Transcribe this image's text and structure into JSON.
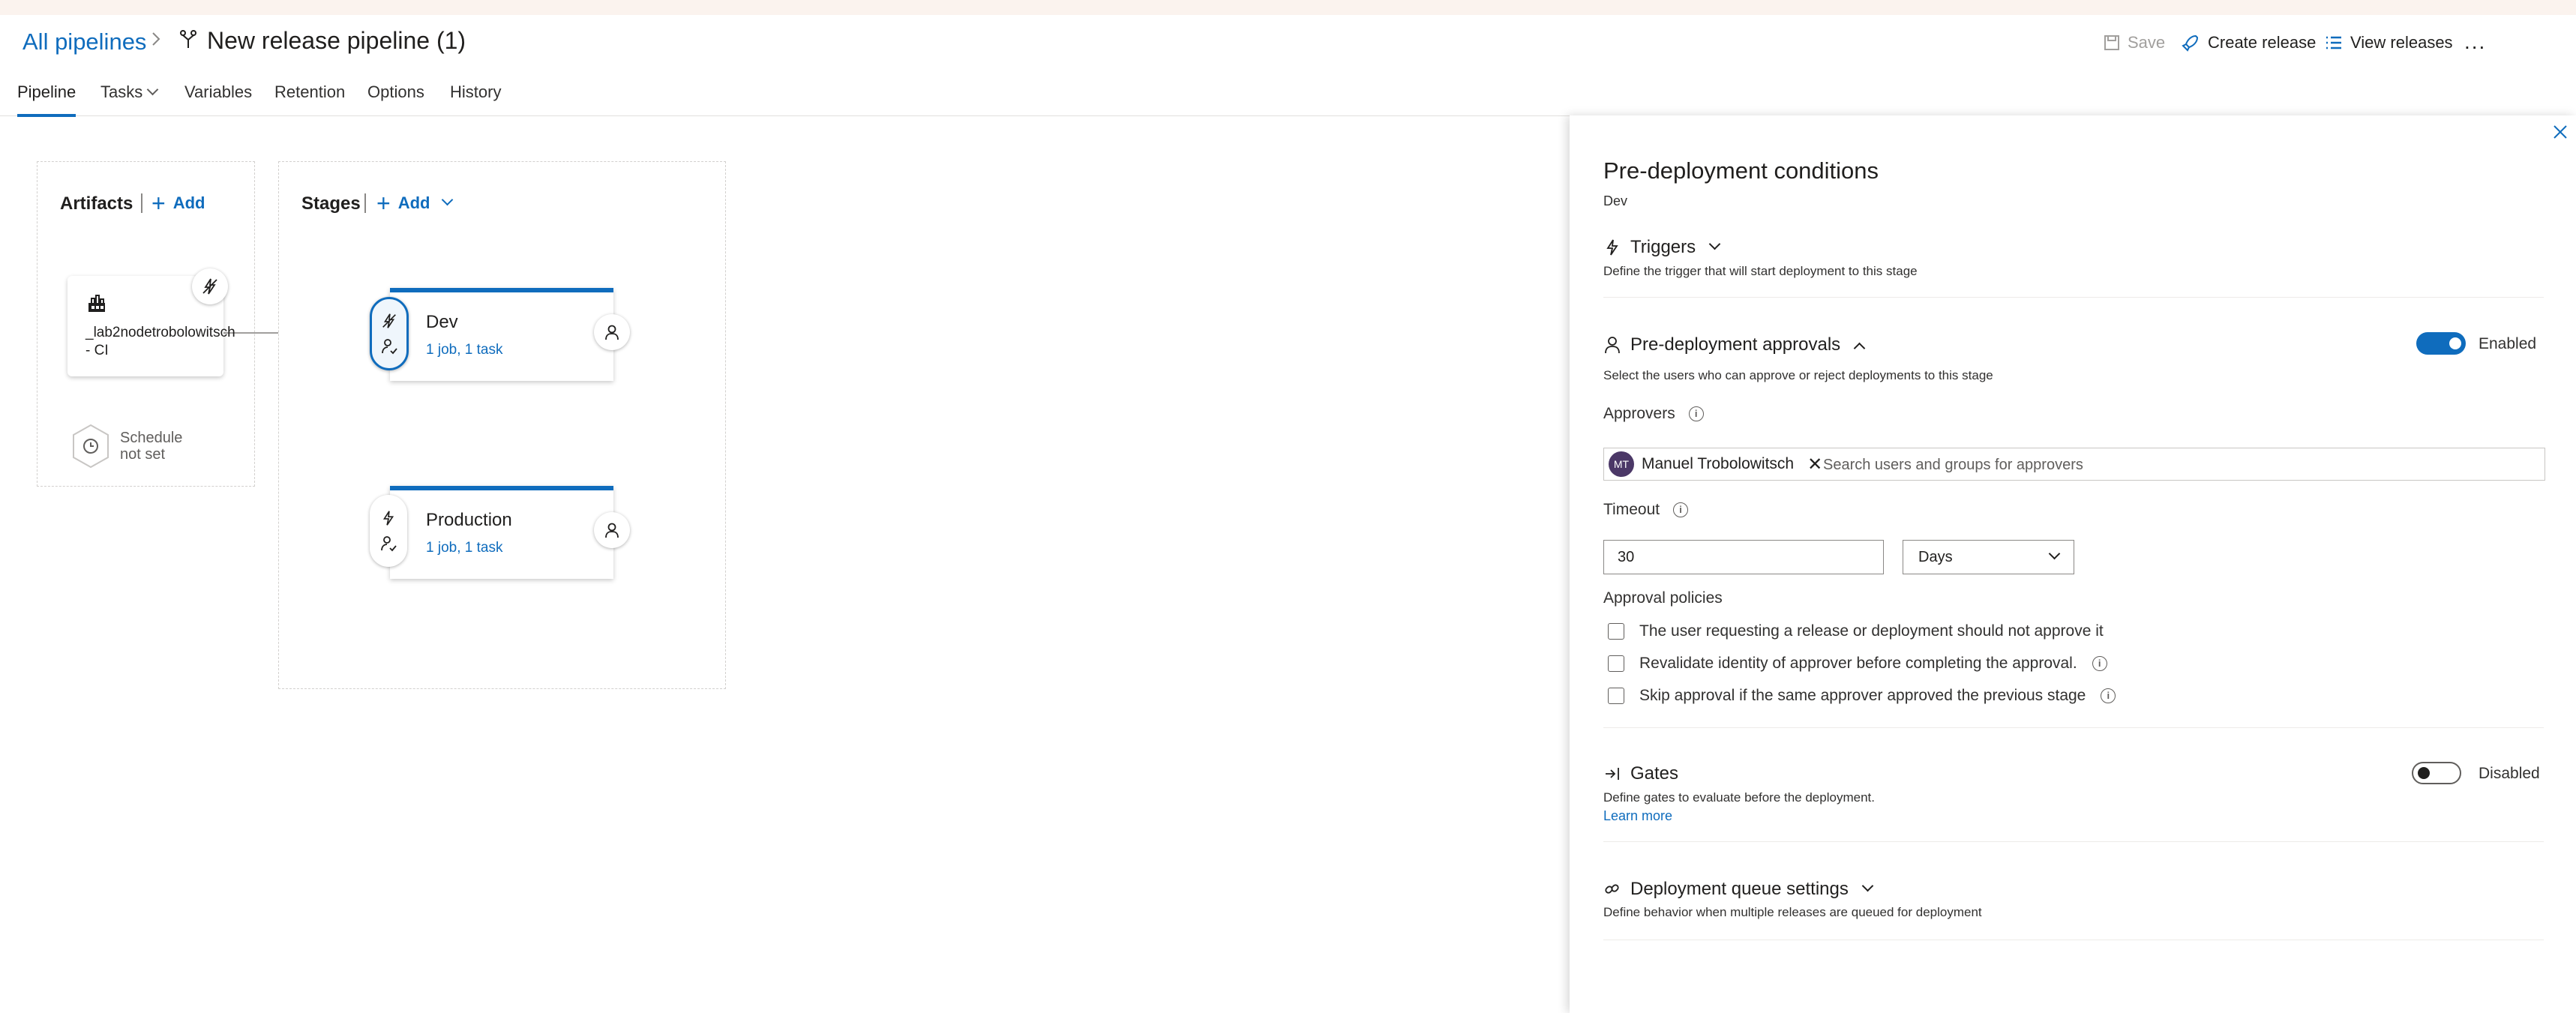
{
  "header": {
    "breadcrumb_root": "All pipelines",
    "pipeline_title": "New release pipeline (1)",
    "save_label": "Save",
    "create_release_label": "Create release",
    "view_releases_label": "View releases",
    "more_label": "..."
  },
  "tabs": [
    {
      "label": "Pipeline",
      "active": true
    },
    {
      "label": "Tasks"
    },
    {
      "label": "Variables"
    },
    {
      "label": "Retention"
    },
    {
      "label": "Options"
    },
    {
      "label": "History"
    }
  ],
  "artifacts": {
    "title": "Artifacts",
    "add_label": "Add",
    "items": [
      {
        "name": "_lab2nodetrobolowitsch - CI"
      }
    ],
    "schedule_line1": "Schedule",
    "schedule_line2": "not set"
  },
  "stages": {
    "title": "Stages",
    "add_label": "Add",
    "items": [
      {
        "name": "Dev",
        "summary": "1 job, 1 task",
        "selected": true
      },
      {
        "name": "Production",
        "summary": "1 job, 1 task",
        "selected": false
      }
    ]
  },
  "panel": {
    "title": "Pre-deployment conditions",
    "subtitle": "Dev",
    "triggers": {
      "label": "Triggers",
      "description": "Define the trigger that will start deployment to this stage"
    },
    "approvals": {
      "label": "Pre-deployment approvals",
      "toggle_label": "Enabled",
      "enabled": true,
      "description": "Select the users who can approve or reject deployments to this stage",
      "approvers_label": "Approvers",
      "approver": {
        "initials": "MT",
        "name": "Manuel Trobolowitsch"
      },
      "search_placeholder": "Search users and groups for approvers",
      "timeout_label": "Timeout",
      "timeout_value": "30",
      "timeout_unit": "Days",
      "policies_label": "Approval policies",
      "policies": [
        {
          "label": "The user requesting a release or deployment should not approve it",
          "checked": false,
          "info": false
        },
        {
          "label": "Revalidate identity of approver before completing the approval.",
          "checked": false,
          "info": true
        },
        {
          "label": "Skip approval if the same approver approved the previous stage",
          "checked": false,
          "info": true
        }
      ]
    },
    "gates": {
      "label": "Gates",
      "toggle_label": "Disabled",
      "enabled": false,
      "description": "Define gates to evaluate before the deployment.",
      "learn_more": "Learn more"
    },
    "queue": {
      "label": "Deployment queue settings",
      "description": "Define behavior when multiple releases are queued for deployment"
    }
  },
  "colors": {
    "accent": "#0f6cbd",
    "avatar": "#4b3867",
    "top_strip": "#fbf3ee"
  }
}
